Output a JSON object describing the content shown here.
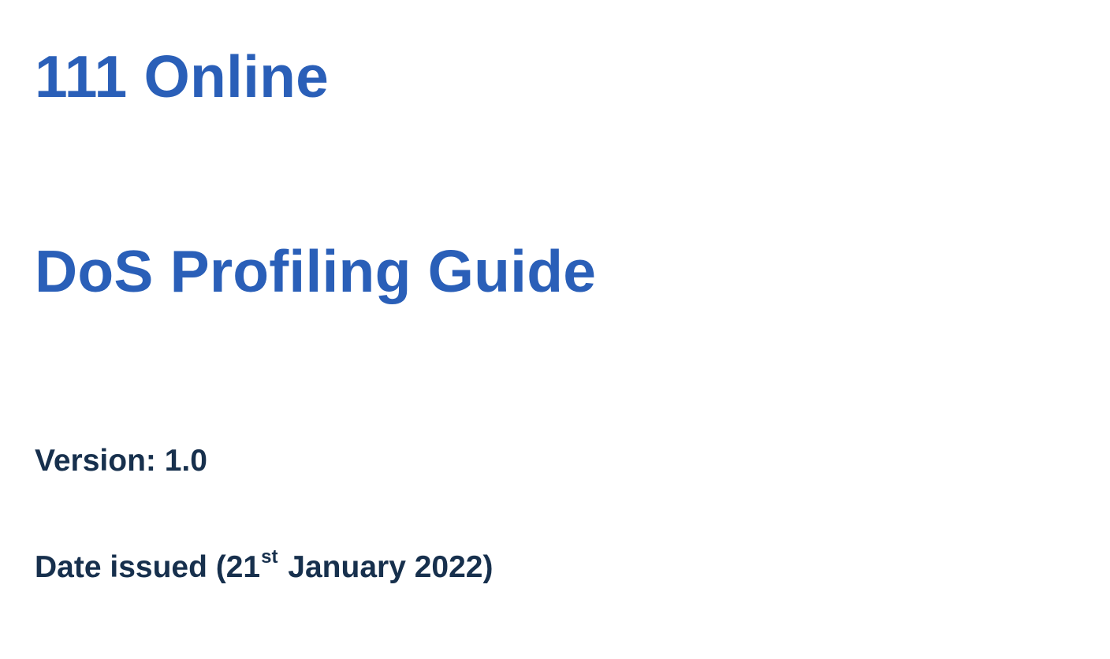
{
  "document": {
    "title": "111 Online",
    "subtitle": "DoS Profiling Guide",
    "version_line": "Version: 1.0",
    "date_issued": {
      "prefix": "Date issued (21",
      "ordinal_suffix": "st",
      "suffix": " January 2022)"
    }
  },
  "colors": {
    "title": "#2a5fb8",
    "meta_text": "#17304d",
    "background": "#ffffff"
  }
}
